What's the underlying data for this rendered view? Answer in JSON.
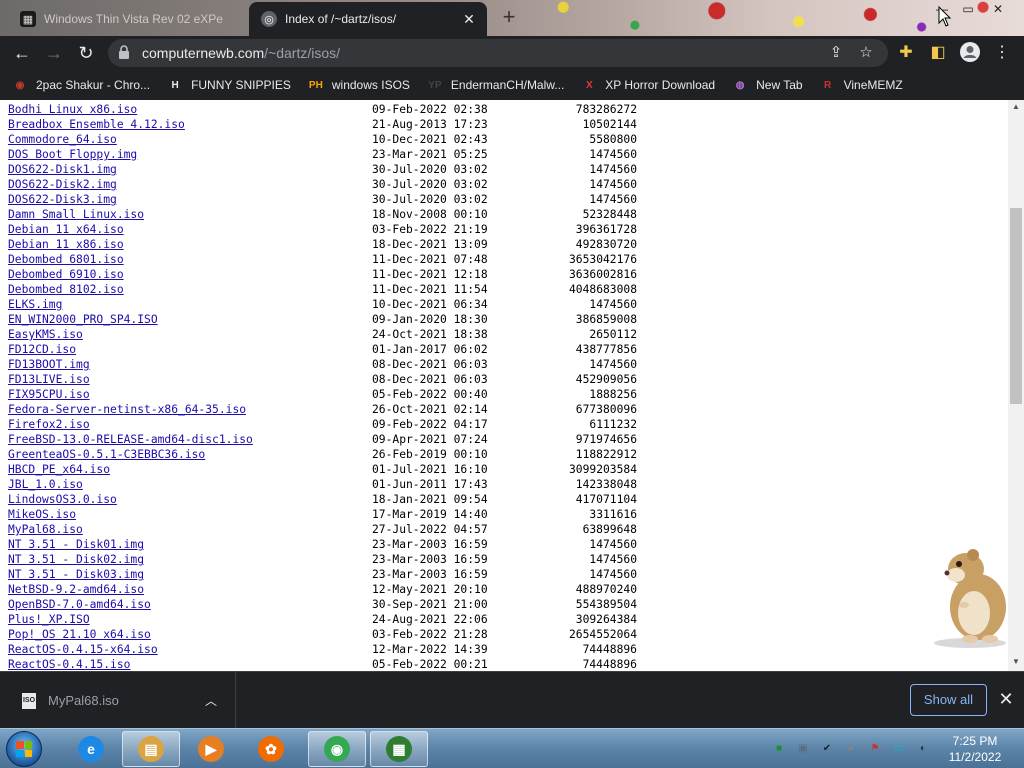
{
  "tabs": [
    {
      "title": "Windows Thin Vista Rev 02 eXPe",
      "favicon": "window-icon",
      "active": false
    },
    {
      "title": "Index of /~dartz/isos/",
      "favicon": "globe-icon",
      "active": true
    }
  ],
  "window_controls": {
    "minimize": "—",
    "maximize": "▭",
    "close": "✕"
  },
  "address_bar": {
    "host": "computernewb.com",
    "path": "/~dartz/isos/"
  },
  "bookmarks": [
    {
      "label": "2pac Shakur - Chro...",
      "icon": "2pac-icon",
      "glyph": "◉",
      "color": "#c0392b"
    },
    {
      "label": "FUNNY SNIPPIES",
      "icon": "h-icon",
      "glyph": "H",
      "color": "#e8eaed"
    },
    {
      "label": "windows ISOS",
      "icon": "ph-icon",
      "glyph": "PH",
      "color": "#f7a600"
    },
    {
      "label": "EndermanCH/Malw...",
      "icon": "yp-icon",
      "glyph": "YP",
      "color": "#444"
    },
    {
      "label": "XP Horror Download",
      "icon": "x-icon",
      "glyph": "X",
      "color": "#e53935"
    },
    {
      "label": "New Tab",
      "icon": "newtab-icon",
      "glyph": "◍",
      "color": "#b06fd0"
    },
    {
      "label": "VineMEMZ",
      "icon": "vine-icon",
      "glyph": "R",
      "color": "#d32f2f"
    }
  ],
  "files": [
    {
      "name": "Bodhi Linux x86.iso",
      "date": "09-Feb-2022 02:38",
      "size": "783286272"
    },
    {
      "name": "Breadbox Ensemble 4.12.iso",
      "date": "21-Aug-2013 17:23",
      "size": "10502144"
    },
    {
      "name": "Commodore_64.iso",
      "date": "10-Dec-2021 02:43",
      "size": "5580800"
    },
    {
      "name": "DOS Boot Floppy.img",
      "date": "23-Mar-2021 05:25",
      "size": "1474560"
    },
    {
      "name": "DOS622-Disk1.img",
      "date": "30-Jul-2020 03:02",
      "size": "1474560"
    },
    {
      "name": "DOS622-Disk2.img",
      "date": "30-Jul-2020 03:02",
      "size": "1474560"
    },
    {
      "name": "DOS622-Disk3.img",
      "date": "30-Jul-2020 03:02",
      "size": "1474560"
    },
    {
      "name": "Damn Small Linux.iso",
      "date": "18-Nov-2008 00:10",
      "size": "52328448"
    },
    {
      "name": "Debian 11 x64.iso",
      "date": "03-Feb-2022 21:19",
      "size": "396361728"
    },
    {
      "name": "Debian 11 x86.iso",
      "date": "18-Dec-2021 13:09",
      "size": "492830720"
    },
    {
      "name": "Debombed 6801.iso",
      "date": "11-Dec-2021 07:48",
      "size": "3653042176"
    },
    {
      "name": "Debombed 6910.iso",
      "date": "11-Dec-2021 12:18",
      "size": "3636002816"
    },
    {
      "name": "Debombed 8102.iso",
      "date": "11-Dec-2021 11:54",
      "size": "4048683008"
    },
    {
      "name": "ELKS.img",
      "date": "10-Dec-2021 06:34",
      "size": "1474560"
    },
    {
      "name": "EN_WIN2000_PRO_SP4.ISO",
      "date": "09-Jan-2020 18:30",
      "size": "386859008"
    },
    {
      "name": "EasyKMS.iso",
      "date": "24-Oct-2021 18:38",
      "size": "2650112"
    },
    {
      "name": "FD12CD.iso",
      "date": "01-Jan-2017 06:02",
      "size": "438777856"
    },
    {
      "name": "FD13BOOT.img",
      "date": "08-Dec-2021 06:03",
      "size": "1474560"
    },
    {
      "name": "FD13LIVE.iso",
      "date": "08-Dec-2021 06:03",
      "size": "452909056"
    },
    {
      "name": "FIX95CPU.iso",
      "date": "05-Feb-2022 00:40",
      "size": "1888256"
    },
    {
      "name": "Fedora-Server-netinst-x86_64-35.iso",
      "date": "26-Oct-2021 02:14",
      "size": "677380096"
    },
    {
      "name": "Firefox2.iso",
      "date": "09-Feb-2022 04:17",
      "size": "6111232"
    },
    {
      "name": "FreeBSD-13.0-RELEASE-amd64-disc1.iso",
      "date": "09-Apr-2021 07:24",
      "size": "971974656"
    },
    {
      "name": "GreenteaOS-0.5.1-C3EBBC36.iso",
      "date": "26-Feb-2019 00:10",
      "size": "118822912"
    },
    {
      "name": "HBCD_PE_x64.iso",
      "date": "01-Jul-2021 16:10",
      "size": "3099203584"
    },
    {
      "name": "JBL_1.0.iso",
      "date": "01-Jun-2011 17:43",
      "size": "142338048"
    },
    {
      "name": "LindowsOS3.0.iso",
      "date": "18-Jan-2021 09:54",
      "size": "417071104"
    },
    {
      "name": "MikeOS.iso",
      "date": "17-Mar-2019 14:40",
      "size": "3311616"
    },
    {
      "name": "MyPal68.iso",
      "date": "27-Jul-2022 04:57",
      "size": "63899648"
    },
    {
      "name": "NT 3.51 - Disk01.img",
      "date": "23-Mar-2003 16:59",
      "size": "1474560"
    },
    {
      "name": "NT 3.51 - Disk02.img",
      "date": "23-Mar-2003 16:59",
      "size": "1474560"
    },
    {
      "name": "NT 3.51 - Disk03.img",
      "date": "23-Mar-2003 16:59",
      "size": "1474560"
    },
    {
      "name": "NetBSD-9.2-amd64.iso",
      "date": "12-May-2021 20:10",
      "size": "488970240"
    },
    {
      "name": "OpenBSD-7.0-amd64.iso",
      "date": "30-Sep-2021 21:00",
      "size": "554389504"
    },
    {
      "name": "Plus!_XP.ISO",
      "date": "24-Aug-2021 22:06",
      "size": "309264384"
    },
    {
      "name": "Pop!_OS 21.10 x64.iso",
      "date": "03-Feb-2022 21:28",
      "size": "2654552064"
    },
    {
      "name": "ReactOS-0.4.15-x64.iso",
      "date": "12-Mar-2022 14:39",
      "size": "74448896"
    },
    {
      "name": "ReactOS-0.4.15.iso",
      "date": "05-Feb-2022 00:21",
      "size": "74448896"
    }
  ],
  "download_bar": {
    "filename": "MyPal68.iso",
    "file_badge": "ISO",
    "show_all": "Show all"
  },
  "taskbar": {
    "apps": [
      {
        "name": "ie-icon",
        "glyph": "e",
        "color": "#1e88e5",
        "active": false
      },
      {
        "name": "explorer-icon",
        "glyph": "▤",
        "color": "#d9a441",
        "active": true
      },
      {
        "name": "media-player-icon",
        "glyph": "▶",
        "color": "#e67e22",
        "active": false
      },
      {
        "name": "app-icon",
        "glyph": "✿",
        "color": "#ef6c00",
        "active": false
      },
      {
        "name": "chrome-icon",
        "glyph": "◉",
        "color": "#34a853",
        "active": true
      },
      {
        "name": "task-manager-icon",
        "glyph": "▦",
        "color": "#2e7d32",
        "active": true
      }
    ],
    "tray": [
      {
        "name": "tray-green-icon",
        "glyph": "■",
        "color": "#1b8f2e"
      },
      {
        "name": "tray-network-icon",
        "glyph": "▣",
        "color": "#5a6b7b"
      },
      {
        "name": "tray-check-icon",
        "glyph": "✔",
        "color": "#222"
      },
      {
        "name": "tray-search-icon",
        "glyph": "⌕",
        "color": "#e67e22"
      },
      {
        "name": "tray-flag-icon",
        "glyph": "⚑",
        "color": "#d32f2f"
      },
      {
        "name": "tray-monitor-icon",
        "glyph": "▭",
        "color": "#00bcd4"
      },
      {
        "name": "tray-volume-icon",
        "glyph": "◐",
        "color": "#333"
      }
    ],
    "time": "7:25 PM",
    "date": "11/2/2022"
  }
}
